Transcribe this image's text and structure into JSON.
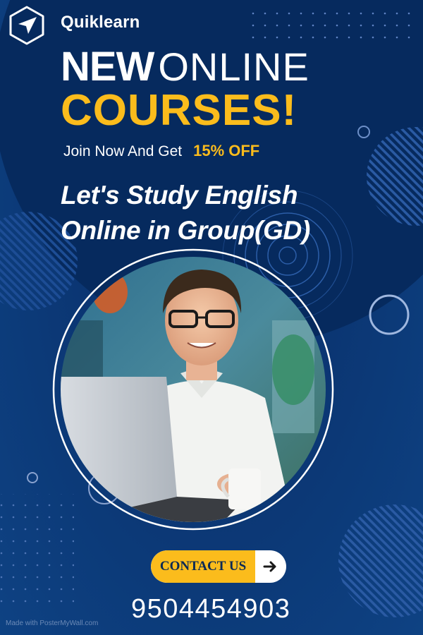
{
  "brand": {
    "name": "Quiklearn",
    "logo_icon": "paper-plane-icon"
  },
  "headline": {
    "line1_bold": "NEW",
    "line1_light": "ONLINE",
    "line2": "COURSES!"
  },
  "offer": {
    "text": "Join  Now And Get",
    "discount": "15% OFF"
  },
  "tagline": {
    "line1": "Let's Study English",
    "line2": "Online in Group(GD)"
  },
  "cta": {
    "label": "CONTACT US",
    "icon": "arrow-right-icon"
  },
  "phone": "9504454903",
  "watermark": "Made with PosterMyWall.com",
  "colors": {
    "background": "#0b3673",
    "accent_yellow": "#fbbc1c",
    "text_white": "#ffffff",
    "cta_text": "#0b2a55"
  }
}
